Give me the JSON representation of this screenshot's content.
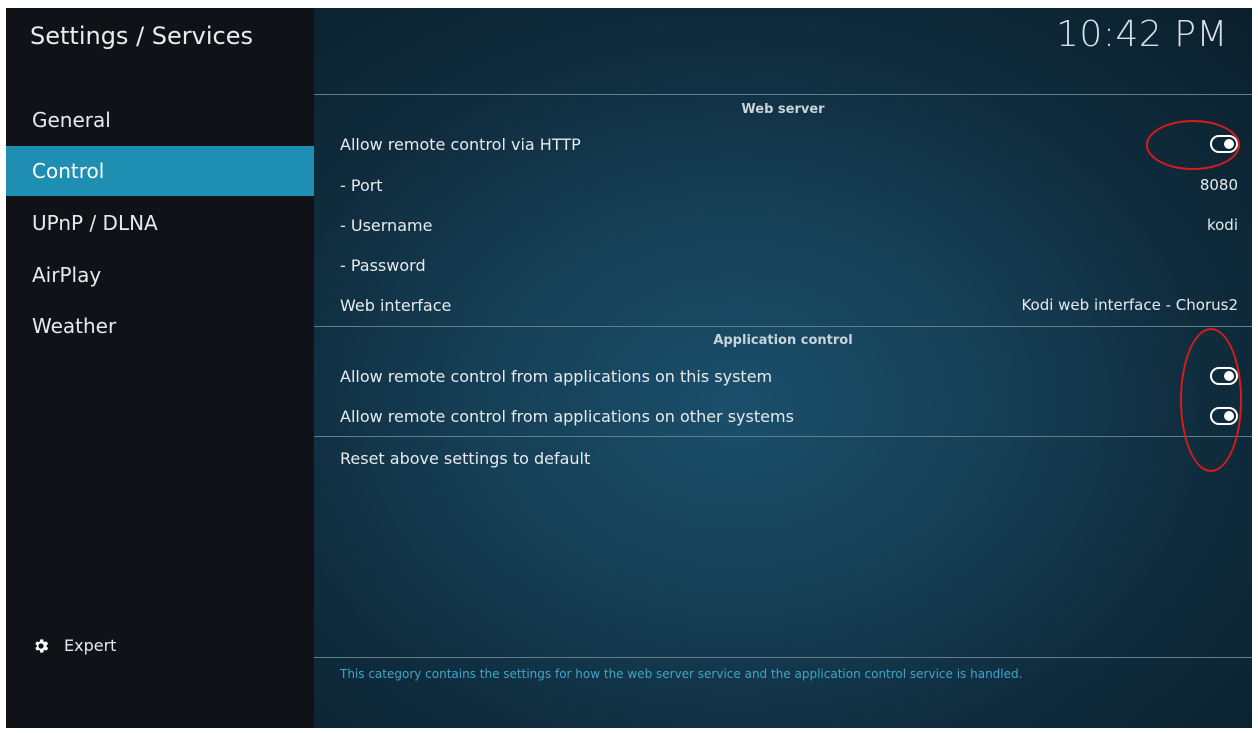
{
  "header": {
    "title": "Settings / Services",
    "clock": "10:42 PM"
  },
  "sidebar": {
    "items": [
      {
        "label": "General"
      },
      {
        "label": "Control"
      },
      {
        "label": "UPnP / DLNA"
      },
      {
        "label": "AirPlay"
      },
      {
        "label": "Weather"
      }
    ],
    "active": "Control",
    "expert": {
      "label": "Expert",
      "icon": "gear-icon"
    }
  },
  "sections": [
    {
      "title": "Web server",
      "rows": [
        {
          "label": "Allow remote control via HTTP",
          "value": "",
          "toggle": true
        },
        {
          "label": "- Port",
          "value": "8080"
        },
        {
          "label": "- Username",
          "value": "kodi"
        },
        {
          "label": "- Password",
          "value": ""
        },
        {
          "label": "Web interface",
          "value": "Kodi web interface - Chorus2"
        }
      ]
    },
    {
      "title": "Application control",
      "rows": [
        {
          "label": "Allow remote control from applications on this system",
          "value": "",
          "toggle": true
        },
        {
          "label": "Allow remote control from applications on other systems",
          "value": "",
          "toggle": true
        }
      ]
    }
  ],
  "reset": {
    "label": "Reset above settings to default"
  },
  "footer": {
    "description": "This category contains the settings for how the web server service and the application control service is handled."
  },
  "colors": {
    "accent": "#1e8fb3",
    "annotation": "#d81b1b",
    "footer_text": "#3fa5c8"
  }
}
